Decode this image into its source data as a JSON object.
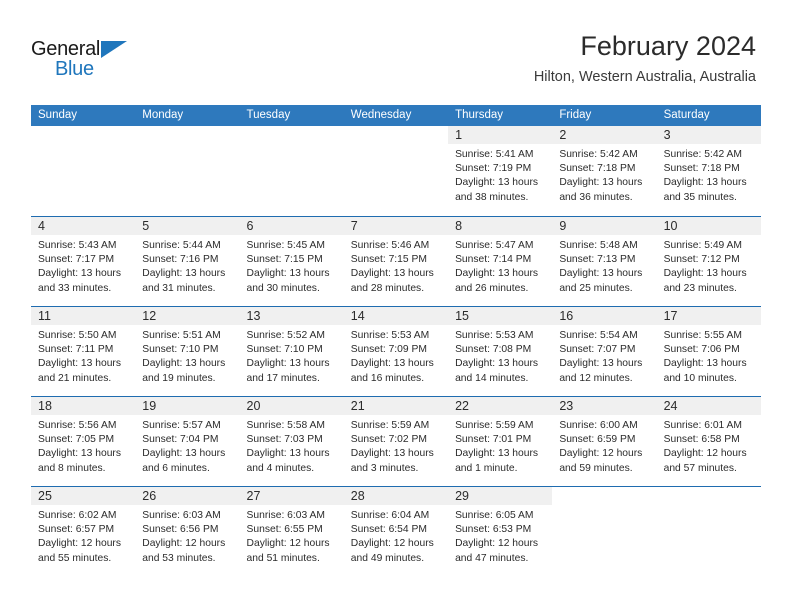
{
  "brand": {
    "name_part1": "General",
    "name_part2": "Blue",
    "triangle_color": "#1f76bc"
  },
  "header": {
    "title": "February 2024",
    "subtitle": "Hilton, Western Australia, Australia"
  },
  "theme": {
    "header_blue": "#2e79bd",
    "row_divider_blue": "#1f6cb0",
    "day_band_gray": "#f0f0f0",
    "text": "#2b2b2b"
  },
  "labels": {
    "sunrise_prefix": "Sunrise:",
    "sunset_prefix": "Sunset:",
    "daylight_prefix": "Daylight:"
  },
  "weekday_headers": [
    "Sunday",
    "Monday",
    "Tuesday",
    "Wednesday",
    "Thursday",
    "Friday",
    "Saturday"
  ],
  "weeks": [
    [
      {
        "day": "",
        "blank": true
      },
      {
        "day": "",
        "blank": true
      },
      {
        "day": "",
        "blank": true
      },
      {
        "day": "",
        "blank": true
      },
      {
        "day": "1",
        "sunrise": "Sunrise: 5:41 AM",
        "sunset": "Sunset: 7:19 PM",
        "daylight_line1": "Daylight: 13 hours",
        "daylight_line2": "and 38 minutes."
      },
      {
        "day": "2",
        "sunrise": "Sunrise: 5:42 AM",
        "sunset": "Sunset: 7:18 PM",
        "daylight_line1": "Daylight: 13 hours",
        "daylight_line2": "and 36 minutes."
      },
      {
        "day": "3",
        "sunrise": "Sunrise: 5:42 AM",
        "sunset": "Sunset: 7:18 PM",
        "daylight_line1": "Daylight: 13 hours",
        "daylight_line2": "and 35 minutes."
      }
    ],
    [
      {
        "day": "4",
        "sunrise": "Sunrise: 5:43 AM",
        "sunset": "Sunset: 7:17 PM",
        "daylight_line1": "Daylight: 13 hours",
        "daylight_line2": "and 33 minutes."
      },
      {
        "day": "5",
        "sunrise": "Sunrise: 5:44 AM",
        "sunset": "Sunset: 7:16 PM",
        "daylight_line1": "Daylight: 13 hours",
        "daylight_line2": "and 31 minutes."
      },
      {
        "day": "6",
        "sunrise": "Sunrise: 5:45 AM",
        "sunset": "Sunset: 7:15 PM",
        "daylight_line1": "Daylight: 13 hours",
        "daylight_line2": "and 30 minutes."
      },
      {
        "day": "7",
        "sunrise": "Sunrise: 5:46 AM",
        "sunset": "Sunset: 7:15 PM",
        "daylight_line1": "Daylight: 13 hours",
        "daylight_line2": "and 28 minutes."
      },
      {
        "day": "8",
        "sunrise": "Sunrise: 5:47 AM",
        "sunset": "Sunset: 7:14 PM",
        "daylight_line1": "Daylight: 13 hours",
        "daylight_line2": "and 26 minutes."
      },
      {
        "day": "9",
        "sunrise": "Sunrise: 5:48 AM",
        "sunset": "Sunset: 7:13 PM",
        "daylight_line1": "Daylight: 13 hours",
        "daylight_line2": "and 25 minutes."
      },
      {
        "day": "10",
        "sunrise": "Sunrise: 5:49 AM",
        "sunset": "Sunset: 7:12 PM",
        "daylight_line1": "Daylight: 13 hours",
        "daylight_line2": "and 23 minutes."
      }
    ],
    [
      {
        "day": "11",
        "sunrise": "Sunrise: 5:50 AM",
        "sunset": "Sunset: 7:11 PM",
        "daylight_line1": "Daylight: 13 hours",
        "daylight_line2": "and 21 minutes."
      },
      {
        "day": "12",
        "sunrise": "Sunrise: 5:51 AM",
        "sunset": "Sunset: 7:10 PM",
        "daylight_line1": "Daylight: 13 hours",
        "daylight_line2": "and 19 minutes."
      },
      {
        "day": "13",
        "sunrise": "Sunrise: 5:52 AM",
        "sunset": "Sunset: 7:10 PM",
        "daylight_line1": "Daylight: 13 hours",
        "daylight_line2": "and 17 minutes."
      },
      {
        "day": "14",
        "sunrise": "Sunrise: 5:53 AM",
        "sunset": "Sunset: 7:09 PM",
        "daylight_line1": "Daylight: 13 hours",
        "daylight_line2": "and 16 minutes."
      },
      {
        "day": "15",
        "sunrise": "Sunrise: 5:53 AM",
        "sunset": "Sunset: 7:08 PM",
        "daylight_line1": "Daylight: 13 hours",
        "daylight_line2": "and 14 minutes."
      },
      {
        "day": "16",
        "sunrise": "Sunrise: 5:54 AM",
        "sunset": "Sunset: 7:07 PM",
        "daylight_line1": "Daylight: 13 hours",
        "daylight_line2": "and 12 minutes."
      },
      {
        "day": "17",
        "sunrise": "Sunrise: 5:55 AM",
        "sunset": "Sunset: 7:06 PM",
        "daylight_line1": "Daylight: 13 hours",
        "daylight_line2": "and 10 minutes."
      }
    ],
    [
      {
        "day": "18",
        "sunrise": "Sunrise: 5:56 AM",
        "sunset": "Sunset: 7:05 PM",
        "daylight_line1": "Daylight: 13 hours",
        "daylight_line2": "and 8 minutes."
      },
      {
        "day": "19",
        "sunrise": "Sunrise: 5:57 AM",
        "sunset": "Sunset: 7:04 PM",
        "daylight_line1": "Daylight: 13 hours",
        "daylight_line2": "and 6 minutes."
      },
      {
        "day": "20",
        "sunrise": "Sunrise: 5:58 AM",
        "sunset": "Sunset: 7:03 PM",
        "daylight_line1": "Daylight: 13 hours",
        "daylight_line2": "and 4 minutes."
      },
      {
        "day": "21",
        "sunrise": "Sunrise: 5:59 AM",
        "sunset": "Sunset: 7:02 PM",
        "daylight_line1": "Daylight: 13 hours",
        "daylight_line2": "and 3 minutes."
      },
      {
        "day": "22",
        "sunrise": "Sunrise: 5:59 AM",
        "sunset": "Sunset: 7:01 PM",
        "daylight_line1": "Daylight: 13 hours",
        "daylight_line2": "and 1 minute."
      },
      {
        "day": "23",
        "sunrise": "Sunrise: 6:00 AM",
        "sunset": "Sunset: 6:59 PM",
        "daylight_line1": "Daylight: 12 hours",
        "daylight_line2": "and 59 minutes."
      },
      {
        "day": "24",
        "sunrise": "Sunrise: 6:01 AM",
        "sunset": "Sunset: 6:58 PM",
        "daylight_line1": "Daylight: 12 hours",
        "daylight_line2": "and 57 minutes."
      }
    ],
    [
      {
        "day": "25",
        "sunrise": "Sunrise: 6:02 AM",
        "sunset": "Sunset: 6:57 PM",
        "daylight_line1": "Daylight: 12 hours",
        "daylight_line2": "and 55 minutes."
      },
      {
        "day": "26",
        "sunrise": "Sunrise: 6:03 AM",
        "sunset": "Sunset: 6:56 PM",
        "daylight_line1": "Daylight: 12 hours",
        "daylight_line2": "and 53 minutes."
      },
      {
        "day": "27",
        "sunrise": "Sunrise: 6:03 AM",
        "sunset": "Sunset: 6:55 PM",
        "daylight_line1": "Daylight: 12 hours",
        "daylight_line2": "and 51 minutes."
      },
      {
        "day": "28",
        "sunrise": "Sunrise: 6:04 AM",
        "sunset": "Sunset: 6:54 PM",
        "daylight_line1": "Daylight: 12 hours",
        "daylight_line2": "and 49 minutes."
      },
      {
        "day": "29",
        "sunrise": "Sunrise: 6:05 AM",
        "sunset": "Sunset: 6:53 PM",
        "daylight_line1": "Daylight: 12 hours",
        "daylight_line2": "and 47 minutes."
      },
      {
        "day": "",
        "blank": true
      },
      {
        "day": "",
        "blank": true
      }
    ]
  ]
}
